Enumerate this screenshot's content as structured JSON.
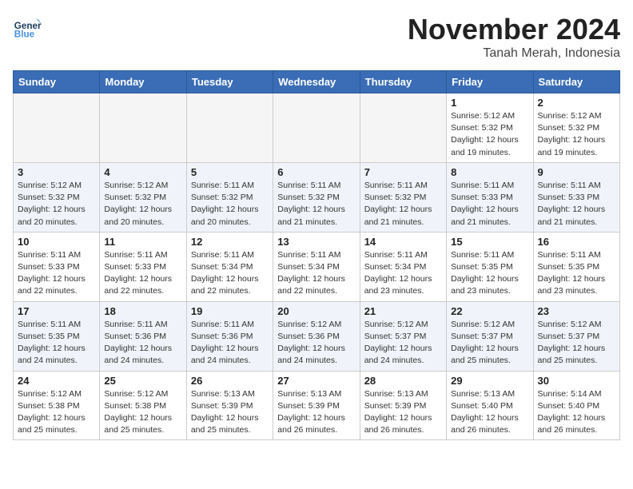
{
  "header": {
    "logo_line1": "General",
    "logo_line2": "Blue",
    "month": "November 2024",
    "location": "Tanah Merah, Indonesia"
  },
  "weekdays": [
    "Sunday",
    "Monday",
    "Tuesday",
    "Wednesday",
    "Thursday",
    "Friday",
    "Saturday"
  ],
  "weeks": [
    [
      {
        "day": "",
        "info": ""
      },
      {
        "day": "",
        "info": ""
      },
      {
        "day": "",
        "info": ""
      },
      {
        "day": "",
        "info": ""
      },
      {
        "day": "",
        "info": ""
      },
      {
        "day": "1",
        "info": "Sunrise: 5:12 AM\nSunset: 5:32 PM\nDaylight: 12 hours and 19 minutes."
      },
      {
        "day": "2",
        "info": "Sunrise: 5:12 AM\nSunset: 5:32 PM\nDaylight: 12 hours and 19 minutes."
      }
    ],
    [
      {
        "day": "3",
        "info": "Sunrise: 5:12 AM\nSunset: 5:32 PM\nDaylight: 12 hours and 20 minutes."
      },
      {
        "day": "4",
        "info": "Sunrise: 5:12 AM\nSunset: 5:32 PM\nDaylight: 12 hours and 20 minutes."
      },
      {
        "day": "5",
        "info": "Sunrise: 5:11 AM\nSunset: 5:32 PM\nDaylight: 12 hours and 20 minutes."
      },
      {
        "day": "6",
        "info": "Sunrise: 5:11 AM\nSunset: 5:32 PM\nDaylight: 12 hours and 21 minutes."
      },
      {
        "day": "7",
        "info": "Sunrise: 5:11 AM\nSunset: 5:32 PM\nDaylight: 12 hours and 21 minutes."
      },
      {
        "day": "8",
        "info": "Sunrise: 5:11 AM\nSunset: 5:33 PM\nDaylight: 12 hours and 21 minutes."
      },
      {
        "day": "9",
        "info": "Sunrise: 5:11 AM\nSunset: 5:33 PM\nDaylight: 12 hours and 21 minutes."
      }
    ],
    [
      {
        "day": "10",
        "info": "Sunrise: 5:11 AM\nSunset: 5:33 PM\nDaylight: 12 hours and 22 minutes."
      },
      {
        "day": "11",
        "info": "Sunrise: 5:11 AM\nSunset: 5:33 PM\nDaylight: 12 hours and 22 minutes."
      },
      {
        "day": "12",
        "info": "Sunrise: 5:11 AM\nSunset: 5:34 PM\nDaylight: 12 hours and 22 minutes."
      },
      {
        "day": "13",
        "info": "Sunrise: 5:11 AM\nSunset: 5:34 PM\nDaylight: 12 hours and 22 minutes."
      },
      {
        "day": "14",
        "info": "Sunrise: 5:11 AM\nSunset: 5:34 PM\nDaylight: 12 hours and 23 minutes."
      },
      {
        "day": "15",
        "info": "Sunrise: 5:11 AM\nSunset: 5:35 PM\nDaylight: 12 hours and 23 minutes."
      },
      {
        "day": "16",
        "info": "Sunrise: 5:11 AM\nSunset: 5:35 PM\nDaylight: 12 hours and 23 minutes."
      }
    ],
    [
      {
        "day": "17",
        "info": "Sunrise: 5:11 AM\nSunset: 5:35 PM\nDaylight: 12 hours and 24 minutes."
      },
      {
        "day": "18",
        "info": "Sunrise: 5:11 AM\nSunset: 5:36 PM\nDaylight: 12 hours and 24 minutes."
      },
      {
        "day": "19",
        "info": "Sunrise: 5:11 AM\nSunset: 5:36 PM\nDaylight: 12 hours and 24 minutes."
      },
      {
        "day": "20",
        "info": "Sunrise: 5:12 AM\nSunset: 5:36 PM\nDaylight: 12 hours and 24 minutes."
      },
      {
        "day": "21",
        "info": "Sunrise: 5:12 AM\nSunset: 5:37 PM\nDaylight: 12 hours and 24 minutes."
      },
      {
        "day": "22",
        "info": "Sunrise: 5:12 AM\nSunset: 5:37 PM\nDaylight: 12 hours and 25 minutes."
      },
      {
        "day": "23",
        "info": "Sunrise: 5:12 AM\nSunset: 5:37 PM\nDaylight: 12 hours and 25 minutes."
      }
    ],
    [
      {
        "day": "24",
        "info": "Sunrise: 5:12 AM\nSunset: 5:38 PM\nDaylight: 12 hours and 25 minutes."
      },
      {
        "day": "25",
        "info": "Sunrise: 5:12 AM\nSunset: 5:38 PM\nDaylight: 12 hours and 25 minutes."
      },
      {
        "day": "26",
        "info": "Sunrise: 5:13 AM\nSunset: 5:39 PM\nDaylight: 12 hours and 25 minutes."
      },
      {
        "day": "27",
        "info": "Sunrise: 5:13 AM\nSunset: 5:39 PM\nDaylight: 12 hours and 26 minutes."
      },
      {
        "day": "28",
        "info": "Sunrise: 5:13 AM\nSunset: 5:39 PM\nDaylight: 12 hours and 26 minutes."
      },
      {
        "day": "29",
        "info": "Sunrise: 5:13 AM\nSunset: 5:40 PM\nDaylight: 12 hours and 26 minutes."
      },
      {
        "day": "30",
        "info": "Sunrise: 5:14 AM\nSunset: 5:40 PM\nDaylight: 12 hours and 26 minutes."
      }
    ]
  ]
}
